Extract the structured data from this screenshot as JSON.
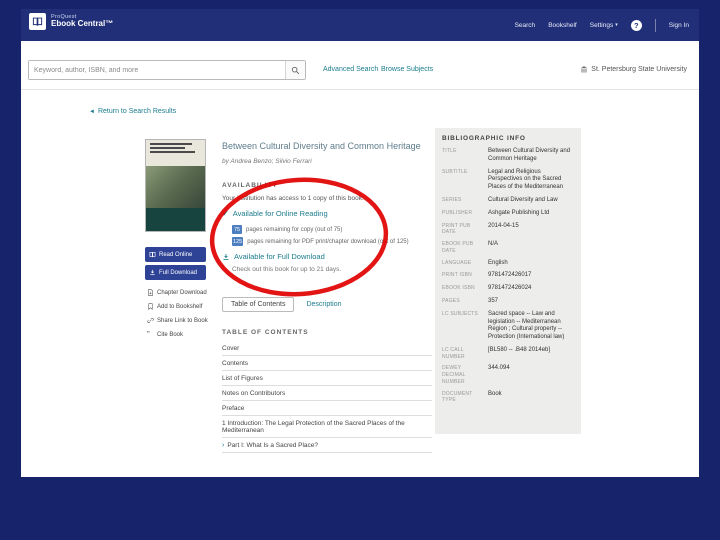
{
  "colors": {
    "slide_bg": "#17246B",
    "header_bg": "#202F78",
    "accent": "#1B7C8D",
    "button_blue": "#2E4396",
    "badge_blue": "#4D7EBF",
    "annotation_red": "#DF0000",
    "panel_bg": "#EDEDEC",
    "title_gray": "#5F7D8C"
  },
  "header": {
    "brand_top": "ProQuest",
    "brand_bottom": "Ebook Central™",
    "nav_search": "Search",
    "nav_bookshelf": "Bookshelf",
    "nav_settings": "Settings",
    "help_glyph": "?",
    "nav_signin": "Sign In"
  },
  "searchbar": {
    "placeholder": "Keyword, author, ISBN, and more",
    "advanced_search": "Advanced Search",
    "browse_subjects": "Browse Subjects",
    "institution": "St. Petersburg State University"
  },
  "breadcrumb": {
    "back_link": "Return to Search Results"
  },
  "sidebar": {
    "read_online": "Read Online",
    "full_download": "Full Download",
    "chapter_download": "Chapter Download",
    "add_to_bookshelf": "Add to Bookshelf",
    "share_link": "Share Link to Book",
    "cite_book": "Cite Book"
  },
  "book": {
    "title": "Between Cultural Diversity and Common Heritage",
    "byline": "by Andrea Benzo; Silvio Ferrari",
    "availability": {
      "heading": "AVAILABILITY",
      "access_note": "Your institution has access to 1 copy of this book.",
      "online_reading": "Available for Online Reading",
      "copy_badge": "75",
      "copy_text": "pages remaining for copy (out of 75)",
      "print_badge": "125",
      "print_text": "pages remaining for PDF print/chapter download (out of 125)",
      "full_download": "Available for Full Download",
      "checkout_note": "Check out this book for up to 21 days."
    },
    "tabs": [
      {
        "label": "Table of Contents",
        "active": true
      },
      {
        "label": "Description",
        "active": false
      }
    ],
    "toc_heading": "TABLE OF CONTENTS",
    "toc": [
      "Cover",
      "Contents",
      "List of Figures",
      "Notes on Contributors",
      "Preface",
      "1 Introduction: The Legal Protection of the Sacred Places of the Mediterranean",
      "Part I: What Is a Sacred Place?"
    ],
    "toc_expand_glyph": "›"
  },
  "biblio": {
    "heading": "BIBLIOGRAPHIC INFO",
    "rows": [
      {
        "label": "Title",
        "value": "Between Cultural Diversity and Common Heritage"
      },
      {
        "label": "Subtitle",
        "value": "Legal and Religious Perspectives on the Sacred Places of the Mediterranean"
      },
      {
        "label": "Series",
        "value": "Cultural Diversity and Law"
      },
      {
        "label": "Publisher",
        "value": "Ashgate Publishing Ltd"
      },
      {
        "label": "Print Pub Date",
        "value": "2014-04-15"
      },
      {
        "label": "Ebook Pub Date",
        "value": "N/A"
      },
      {
        "label": "Language",
        "value": "English"
      },
      {
        "label": "Print ISBN",
        "value": "9781472426017"
      },
      {
        "label": "Ebook ISBN",
        "value": "9781472426024"
      },
      {
        "label": "Pages",
        "value": "357"
      },
      {
        "label": "LC Subjects",
        "value": "Sacred space -- Law and legislation -- Mediterranean Region ; Cultural property -- Protection (International law)"
      },
      {
        "label": "LC Call Number",
        "value": "[BL580 -- .B48 2014eb]"
      },
      {
        "label": "Dewey Decimal Number",
        "value": "344.094"
      },
      {
        "label": "Document Type",
        "value": "Book"
      }
    ]
  }
}
